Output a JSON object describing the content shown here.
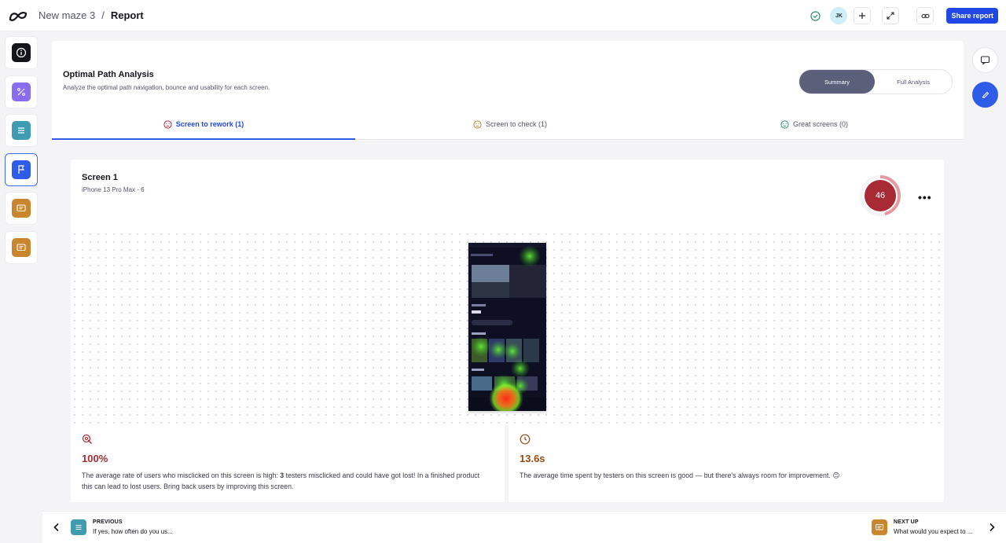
{
  "topbar": {
    "project": "New maze 3",
    "separator": "/",
    "page": "Report",
    "avatar_initials": "JK",
    "share_label": "Share report"
  },
  "left_rail": {
    "items": [
      {
        "icon": "info-icon",
        "color": "#14141b"
      },
      {
        "icon": "percent-icon",
        "color": "#8a6cf0"
      },
      {
        "icon": "list-icon",
        "color": "#3f9bb0"
      },
      {
        "icon": "flag-icon",
        "color": "#2e5ce8"
      },
      {
        "icon": "comment-icon",
        "color": "#c9862e"
      },
      {
        "icon": "comment-icon",
        "color": "#c9862e"
      }
    ]
  },
  "report": {
    "title": "Optimal Path Analysis",
    "subtitle": "Analyze the optimal path navigation, bounce and usability for each screen.",
    "toggle": {
      "summary": "Summary",
      "full": "Full Analysis"
    },
    "tabs": [
      {
        "label": "Screen to rework (1)",
        "icon": "frown-icon",
        "color": "#c0263a"
      },
      {
        "label": "Screen to check (1)",
        "icon": "neutral-face-icon",
        "color": "#c9862e"
      },
      {
        "label": "Great screens (0)",
        "icon": "smile-icon",
        "color": "#2f8f6a"
      }
    ]
  },
  "screen": {
    "title": "Screen 1",
    "subtitle": "iPhone 13 Pro Max - 6",
    "score": "46",
    "score_percent": 46,
    "score_color": "#a82a34",
    "more": "•••"
  },
  "metrics": {
    "misclick": {
      "value": "100%",
      "text_before": "The average rate of users who misclicked on this screen is high: ",
      "text_bold": "3",
      "text_after": " testers misclicked and could have got lost! In a finished product this can lead to lost users. Bring back users by improving this screen.",
      "color": "#a82a34"
    },
    "time": {
      "value": "13.6s",
      "text": "The average time spent by testers on this screen is good — but there's always room for improvement. 😉",
      "color": "#9a4a0e"
    }
  },
  "bottom": {
    "prev_label": "PREVIOUS",
    "prev_text": "If yes, how often do you us...",
    "next_label": "NEXT UP",
    "next_text": "What would you expect to ..."
  }
}
